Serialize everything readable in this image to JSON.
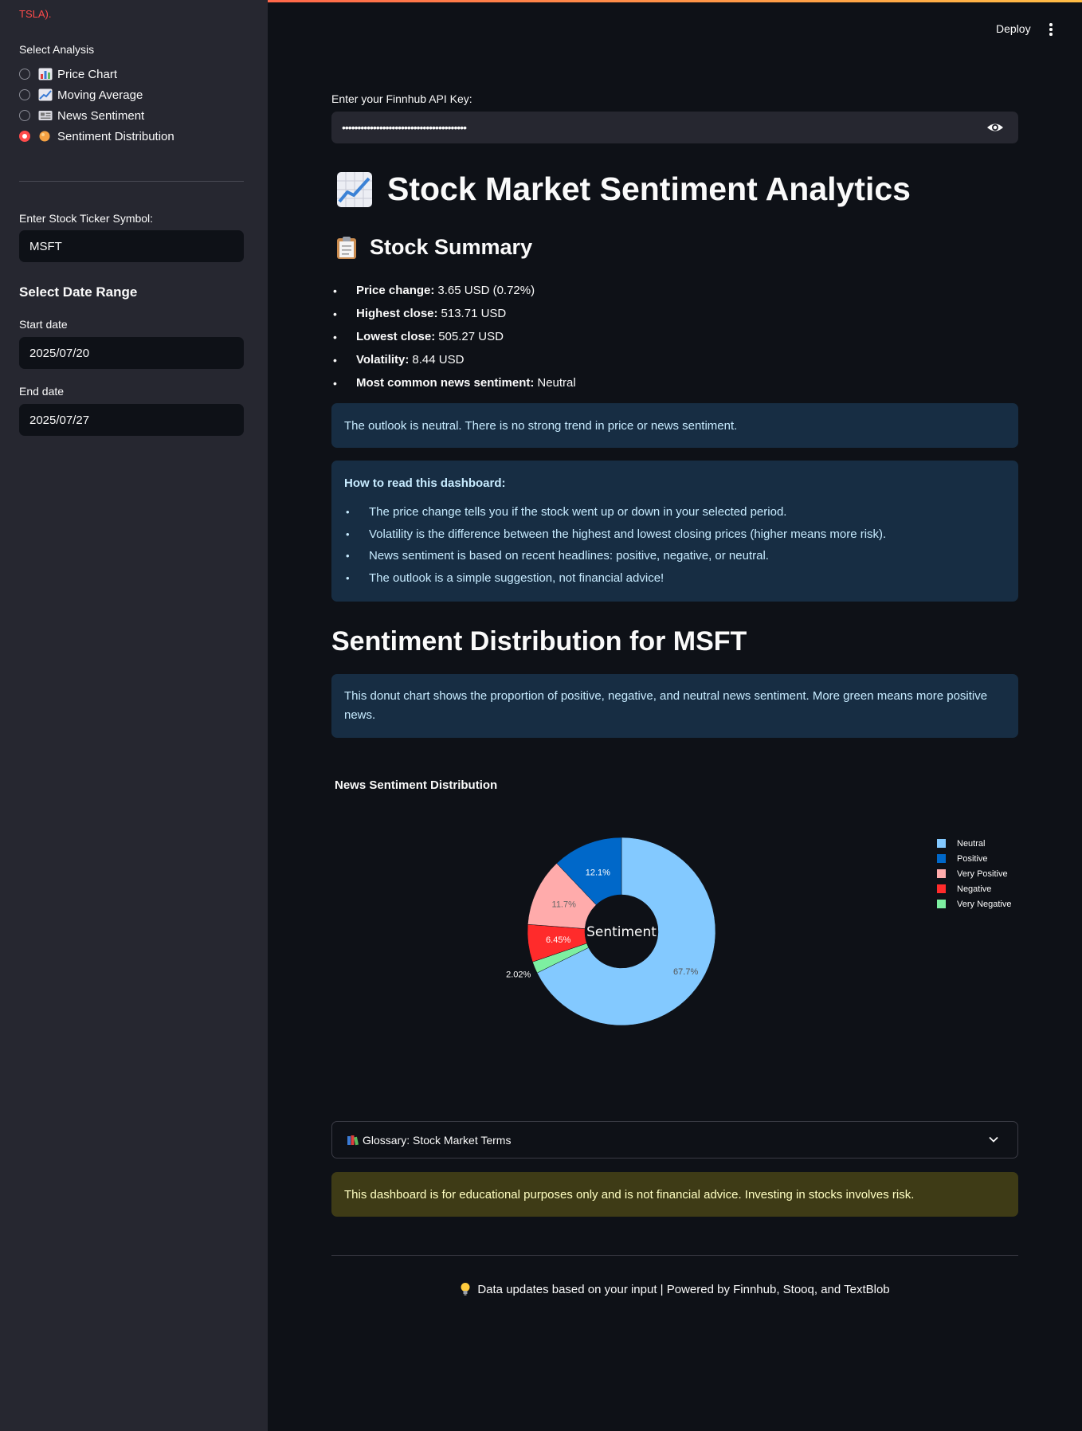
{
  "sidebar": {
    "warning_text": "TSLA).",
    "analysis_label": "Select Analysis",
    "analysis_options": [
      {
        "label": "Price Chart",
        "icon": "bar-chart-icon",
        "selected": false
      },
      {
        "label": "Moving Average",
        "icon": "trend-chart-icon",
        "selected": false
      },
      {
        "label": "News Sentiment",
        "icon": "newspaper-icon",
        "selected": false
      },
      {
        "label": "Sentiment Distribution",
        "icon": "orange-circle-icon",
        "selected": true
      }
    ],
    "ticker_label": "Enter Stock Ticker Symbol:",
    "ticker_value": "MSFT",
    "date_range_heading": "Select Date Range",
    "start_label": "Start date",
    "start_value": "2025/07/20",
    "end_label": "End date",
    "end_value": "2025/07/27"
  },
  "header": {
    "deploy_label": "Deploy"
  },
  "api": {
    "label": "Enter your Finnhub API Key:",
    "masked_value": "••••••••••••••••••••••••••••••••••••••••"
  },
  "title": "Stock Market Sentiment Analytics",
  "summary": {
    "heading": "Stock Summary",
    "items": [
      {
        "key": "Price change:",
        "value": "3.65 USD (0.72%)"
      },
      {
        "key": "Highest close:",
        "value": "513.71 USD"
      },
      {
        "key": "Lowest close:",
        "value": "505.27 USD"
      },
      {
        "key": "Volatility:",
        "value": "8.44 USD"
      },
      {
        "key": "Most common news sentiment:",
        "value": "Neutral"
      }
    ]
  },
  "outlook": "The outlook is neutral. There is no strong trend in price or news sentiment.",
  "howto": {
    "title": "How to read this dashboard:",
    "items": [
      "The price change tells you if the stock went up or down in your selected period.",
      "Volatility is the difference between the highest and lowest closing prices (higher means more risk).",
      "News sentiment is based on recent headlines: positive, negative, or neutral.",
      "The outlook is a simple suggestion, not financial advice!"
    ]
  },
  "section_heading": "Sentiment Distribution for MSFT",
  "chart_info": "This donut chart shows the proportion of positive, negative, and neutral news sentiment. More green means more positive news.",
  "chart_data": {
    "type": "pie",
    "title": "News Sentiment Distribution",
    "center_label": "Sentiment",
    "legend_position": "right",
    "slices": [
      {
        "name": "Neutral",
        "value": 67.7,
        "label": "67.7%",
        "color": "#83c9ff"
      },
      {
        "name": "Very Negative",
        "value": 2.02,
        "label": "2.02%",
        "color": "#7defa1"
      },
      {
        "name": "Negative",
        "value": 6.45,
        "label": "6.45%",
        "color": "#ff2b2b"
      },
      {
        "name": "Very Positive",
        "value": 11.7,
        "label": "11.7%",
        "color": "#ffabab"
      },
      {
        "name": "Positive",
        "value": 12.1,
        "label": "12.1%",
        "color": "#0068c9"
      }
    ],
    "legend": [
      {
        "name": "Neutral",
        "color": "#83c9ff"
      },
      {
        "name": "Positive",
        "color": "#0068c9"
      },
      {
        "name": "Very Positive",
        "color": "#ffabab"
      },
      {
        "name": "Negative",
        "color": "#ff2b2b"
      },
      {
        "name": "Very Negative",
        "color": "#7defa1"
      }
    ]
  },
  "glossary_label": "Glossary: Stock Market Terms",
  "disclaimer": "This dashboard is for educational purposes only and is not financial advice. Investing in stocks involves risk.",
  "footer": "Data updates based on your input | Powered by Finnhub, Stooq, and TextBlob"
}
